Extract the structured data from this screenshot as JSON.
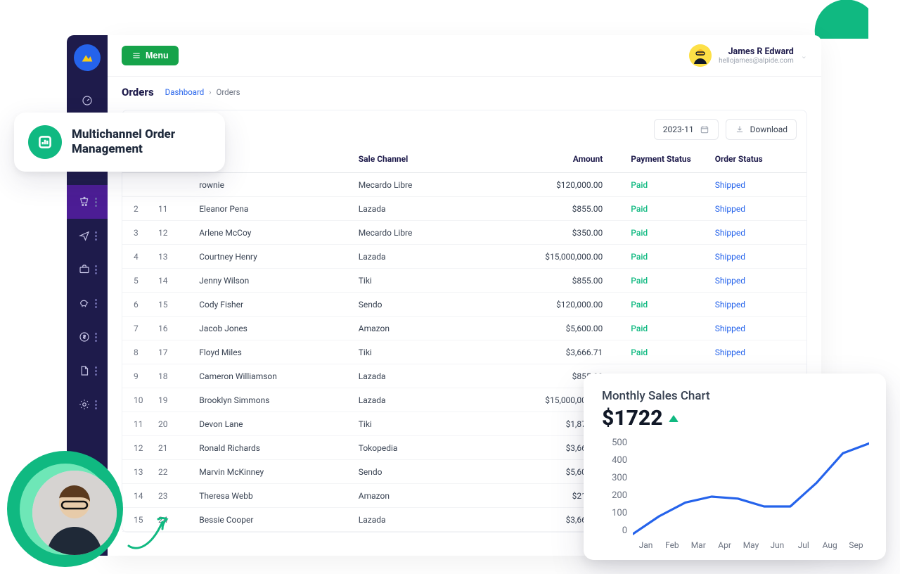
{
  "topbar": {
    "menu_label": "Menu",
    "user_name": "James R Edward",
    "user_email": "hellojames@alpide.com"
  },
  "header": {
    "title": "Orders",
    "breadcrumb_root": "Dashboard",
    "breadcrumb_current": "Orders"
  },
  "filters": {
    "period": "2023-11",
    "download_label": "Download"
  },
  "badge": {
    "title_l1": "Multichannel Order",
    "title_l2": "Management"
  },
  "table": {
    "headers": {
      "channel": "Sale Channel",
      "amount": "Amount",
      "payment": "Payment Status",
      "order": "Order Status"
    },
    "rows": [
      {
        "a": "",
        "b": "",
        "name": "rownie",
        "channel": "Mecardo Libre",
        "amount": "$120,000.00",
        "payment": "Paid",
        "status": "Shipped"
      },
      {
        "a": "2",
        "b": "11",
        "name": "Eleanor Pena",
        "channel": "Lazada",
        "amount": "$855.00",
        "payment": "Paid",
        "status": "Shipped"
      },
      {
        "a": "3",
        "b": "12",
        "name": "Arlene McCoy",
        "channel": "Mecardo Libre",
        "amount": "$350.00",
        "payment": "Paid",
        "status": "Shipped"
      },
      {
        "a": "4",
        "b": "13",
        "name": "Courtney Henry",
        "channel": "Lazada",
        "amount": "$15,000,000.00",
        "payment": "Paid",
        "status": "Shipped"
      },
      {
        "a": "5",
        "b": "14",
        "name": "Jenny Wilson",
        "channel": "Tiki",
        "amount": "$855.00",
        "payment": "Paid",
        "status": "Shipped"
      },
      {
        "a": "6",
        "b": "15",
        "name": "Cody Fisher",
        "channel": "Sendo",
        "amount": "$120,000.00",
        "payment": "Paid",
        "status": "Shipped"
      },
      {
        "a": "7",
        "b": "16",
        "name": "Jacob Jones",
        "channel": "Amazon",
        "amount": "$5,600.00",
        "payment": "Paid",
        "status": "Shipped"
      },
      {
        "a": "8",
        "b": "17",
        "name": "Floyd Miles",
        "channel": "Tiki",
        "amount": "$3,666.71",
        "payment": "Paid",
        "status": "Shipped"
      },
      {
        "a": "9",
        "b": "18",
        "name": "Cameron Williamson",
        "channel": "Lazada",
        "amount": "$855.00",
        "payment": "",
        "status": ""
      },
      {
        "a": "10",
        "b": "19",
        "name": "Brooklyn Simmons",
        "channel": "Lazada",
        "amount": "$15,000,000.00",
        "payment": "",
        "status": ""
      },
      {
        "a": "11",
        "b": "20",
        "name": "Devon Lane",
        "channel": "Tiki",
        "amount": "$1,878.50",
        "payment": "",
        "status": ""
      },
      {
        "a": "12",
        "b": "21",
        "name": "Ronald Richards",
        "channel": "Tokopedia",
        "amount": "$3,666.71",
        "payment": "",
        "status": ""
      },
      {
        "a": "13",
        "b": "22",
        "name": "Marvin McKinney",
        "channel": "Sendo",
        "amount": "$5,600.00",
        "payment": "",
        "status": ""
      },
      {
        "a": "14",
        "b": "23",
        "name": "Theresa Webb",
        "channel": "Amazon",
        "amount": "$210.00",
        "payment": "",
        "status": ""
      },
      {
        "a": "15",
        "b": "24",
        "name": "Bessie Cooper",
        "channel": "Lazada",
        "amount": "$3,666.71",
        "payment": "",
        "status": ""
      }
    ]
  },
  "chart": {
    "title": "Monthly Sales Chart",
    "value": "$1722"
  },
  "chart_data": {
    "type": "line",
    "title": "Monthly Sales Chart",
    "categories": [
      "Jan",
      "Feb",
      "Mar",
      "Apr",
      "May",
      "Jun",
      "Jul",
      "Aug",
      "Sep"
    ],
    "values": [
      10,
      100,
      170,
      200,
      190,
      150,
      150,
      270,
      420,
      470
    ],
    "ylabel": "",
    "xlabel": "",
    "ylim": [
      0,
      500
    ],
    "y_ticks": [
      500,
      400,
      300,
      200,
      100,
      0
    ]
  }
}
